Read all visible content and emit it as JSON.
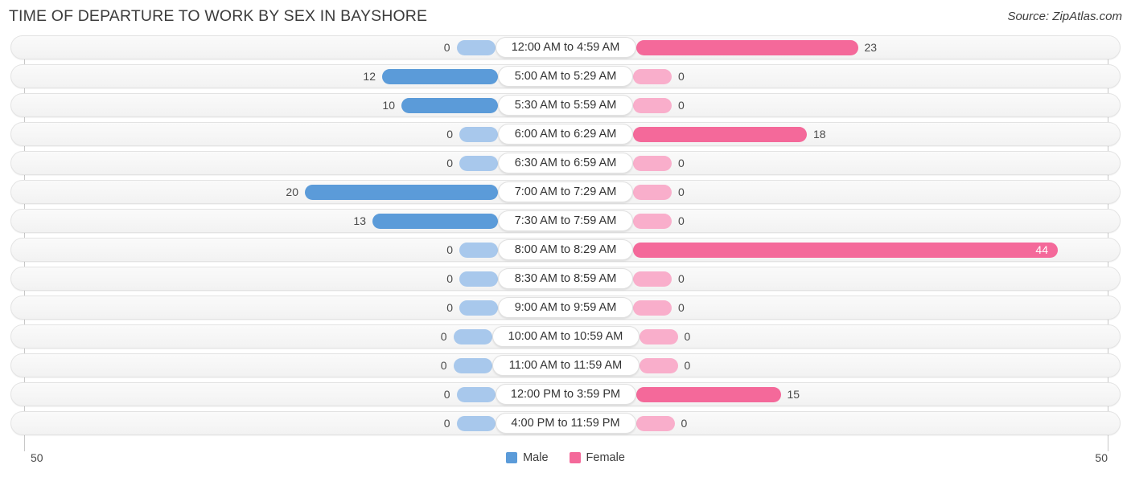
{
  "header": {
    "title": "TIME OF DEPARTURE TO WORK BY SEX IN BAYSHORE",
    "source": "Source: ZipAtlas.com"
  },
  "legend": {
    "male_label": "Male",
    "female_label": "Female",
    "male_color": "#5b9bd9",
    "female_color": "#f4699a"
  },
  "axis": {
    "left_max_label": "50",
    "right_max_label": "50",
    "max": 50
  },
  "chart_data": {
    "type": "bar",
    "title": "TIME OF DEPARTURE TO WORK BY SEX IN BAYSHORE",
    "xlabel": "",
    "ylabel": "",
    "orientation": "horizontal-diverging",
    "xlim": [
      50,
      50
    ],
    "grid": false,
    "legend_position": "bottom-center",
    "categories": [
      "12:00 AM to 4:59 AM",
      "5:00 AM to 5:29 AM",
      "5:30 AM to 5:59 AM",
      "6:00 AM to 6:29 AM",
      "6:30 AM to 6:59 AM",
      "7:00 AM to 7:29 AM",
      "7:30 AM to 7:59 AM",
      "8:00 AM to 8:29 AM",
      "8:30 AM to 8:59 AM",
      "9:00 AM to 9:59 AM",
      "10:00 AM to 10:59 AM",
      "11:00 AM to 11:59 AM",
      "12:00 PM to 3:59 PM",
      "4:00 PM to 11:59 PM"
    ],
    "series": [
      {
        "name": "Male",
        "values": [
          0,
          12,
          10,
          0,
          0,
          20,
          13,
          0,
          0,
          0,
          0,
          0,
          0,
          0
        ]
      },
      {
        "name": "Female",
        "values": [
          23,
          0,
          0,
          18,
          0,
          0,
          0,
          44,
          0,
          0,
          0,
          0,
          15,
          0
        ]
      }
    ]
  },
  "rows": [
    {
      "label": "12:00 AM to 4:59 AM",
      "male": "0",
      "female": "23"
    },
    {
      "label": "5:00 AM to 5:29 AM",
      "male": "12",
      "female": "0"
    },
    {
      "label": "5:30 AM to 5:59 AM",
      "male": "10",
      "female": "0"
    },
    {
      "label": "6:00 AM to 6:29 AM",
      "male": "0",
      "female": "18"
    },
    {
      "label": "6:30 AM to 6:59 AM",
      "male": "0",
      "female": "0"
    },
    {
      "label": "7:00 AM to 7:29 AM",
      "male": "20",
      "female": "0"
    },
    {
      "label": "7:30 AM to 7:59 AM",
      "male": "13",
      "female": "0"
    },
    {
      "label": "8:00 AM to 8:29 AM",
      "male": "0",
      "female": "44"
    },
    {
      "label": "8:30 AM to 8:59 AM",
      "male": "0",
      "female": "0"
    },
    {
      "label": "9:00 AM to 9:59 AM",
      "male": "0",
      "female": "0"
    },
    {
      "label": "10:00 AM to 10:59 AM",
      "male": "0",
      "female": "0"
    },
    {
      "label": "11:00 AM to 11:59 AM",
      "male": "0",
      "female": "0"
    },
    {
      "label": "12:00 PM to 3:59 PM",
      "male": "0",
      "female": "15"
    },
    {
      "label": "4:00 PM to 11:59 PM",
      "male": "0",
      "female": "0"
    }
  ]
}
